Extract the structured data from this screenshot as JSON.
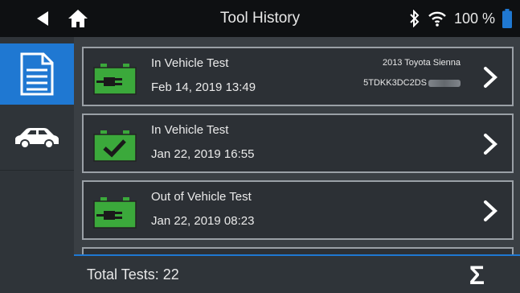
{
  "header": {
    "title": "Tool History",
    "battery_percent": "100 %",
    "back_icon": "back-arrow-icon",
    "home_icon": "home-icon",
    "bluetooth_icon": "bluetooth-icon",
    "wifi_icon": "wifi-icon",
    "battery_icon": "battery-icon"
  },
  "sidebar": {
    "items": [
      {
        "icon": "document-icon",
        "active": true
      },
      {
        "icon": "car-icon",
        "active": false
      }
    ]
  },
  "tests": [
    {
      "type": "In Vehicle Test",
      "date": "Feb 14, 2019 13:49",
      "result_icon": "battery-plug-icon",
      "vehicle": "2013 Toyota Sienna",
      "vin_visible": "5TDKK3DC2DS"
    },
    {
      "type": "In Vehicle Test",
      "date": "Jan 22, 2019 16:55",
      "result_icon": "battery-check-icon"
    },
    {
      "type": "Out of Vehicle Test",
      "date": "Jan 22, 2019 08:23",
      "result_icon": "battery-plug-icon"
    }
  ],
  "footer": {
    "total_label": "Total Tests: 22",
    "sigma": "Σ"
  },
  "colors": {
    "accent": "#1f78d2",
    "battery_green": "#3ba93b",
    "header_bg": "#0e1012"
  }
}
